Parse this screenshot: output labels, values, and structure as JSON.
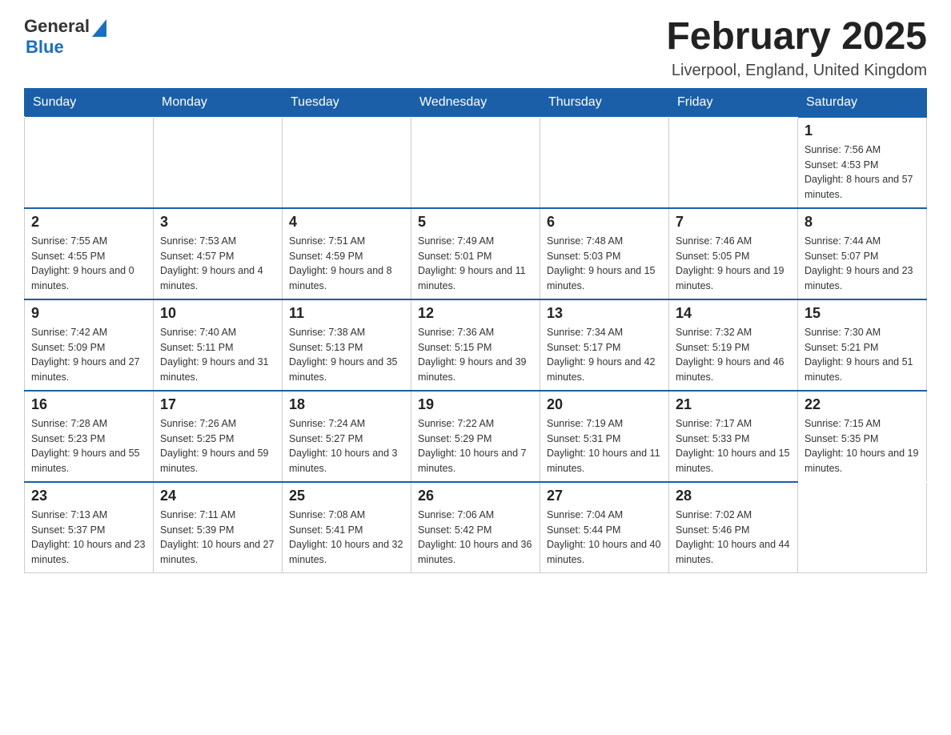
{
  "header": {
    "title": "February 2025",
    "location": "Liverpool, England, United Kingdom",
    "logo_general": "General",
    "logo_blue": "Blue"
  },
  "days_of_week": [
    "Sunday",
    "Monday",
    "Tuesday",
    "Wednesday",
    "Thursday",
    "Friday",
    "Saturday"
  ],
  "weeks": [
    {
      "days": [
        {
          "date": "",
          "info": ""
        },
        {
          "date": "",
          "info": ""
        },
        {
          "date": "",
          "info": ""
        },
        {
          "date": "",
          "info": ""
        },
        {
          "date": "",
          "info": ""
        },
        {
          "date": "",
          "info": ""
        },
        {
          "date": "1",
          "sunrise": "7:56 AM",
          "sunset": "4:53 PM",
          "daylight": "8 hours and 57 minutes."
        }
      ]
    },
    {
      "days": [
        {
          "date": "2",
          "sunrise": "7:55 AM",
          "sunset": "4:55 PM",
          "daylight": "9 hours and 0 minutes."
        },
        {
          "date": "3",
          "sunrise": "7:53 AM",
          "sunset": "4:57 PM",
          "daylight": "9 hours and 4 minutes."
        },
        {
          "date": "4",
          "sunrise": "7:51 AM",
          "sunset": "4:59 PM",
          "daylight": "9 hours and 8 minutes."
        },
        {
          "date": "5",
          "sunrise": "7:49 AM",
          "sunset": "5:01 PM",
          "daylight": "9 hours and 11 minutes."
        },
        {
          "date": "6",
          "sunrise": "7:48 AM",
          "sunset": "5:03 PM",
          "daylight": "9 hours and 15 minutes."
        },
        {
          "date": "7",
          "sunrise": "7:46 AM",
          "sunset": "5:05 PM",
          "daylight": "9 hours and 19 minutes."
        },
        {
          "date": "8",
          "sunrise": "7:44 AM",
          "sunset": "5:07 PM",
          "daylight": "9 hours and 23 minutes."
        }
      ]
    },
    {
      "days": [
        {
          "date": "9",
          "sunrise": "7:42 AM",
          "sunset": "5:09 PM",
          "daylight": "9 hours and 27 minutes."
        },
        {
          "date": "10",
          "sunrise": "7:40 AM",
          "sunset": "5:11 PM",
          "daylight": "9 hours and 31 minutes."
        },
        {
          "date": "11",
          "sunrise": "7:38 AM",
          "sunset": "5:13 PM",
          "daylight": "9 hours and 35 minutes."
        },
        {
          "date": "12",
          "sunrise": "7:36 AM",
          "sunset": "5:15 PM",
          "daylight": "9 hours and 39 minutes."
        },
        {
          "date": "13",
          "sunrise": "7:34 AM",
          "sunset": "5:17 PM",
          "daylight": "9 hours and 42 minutes."
        },
        {
          "date": "14",
          "sunrise": "7:32 AM",
          "sunset": "5:19 PM",
          "daylight": "9 hours and 46 minutes."
        },
        {
          "date": "15",
          "sunrise": "7:30 AM",
          "sunset": "5:21 PM",
          "daylight": "9 hours and 51 minutes."
        }
      ]
    },
    {
      "days": [
        {
          "date": "16",
          "sunrise": "7:28 AM",
          "sunset": "5:23 PM",
          "daylight": "9 hours and 55 minutes."
        },
        {
          "date": "17",
          "sunrise": "7:26 AM",
          "sunset": "5:25 PM",
          "daylight": "9 hours and 59 minutes."
        },
        {
          "date": "18",
          "sunrise": "7:24 AM",
          "sunset": "5:27 PM",
          "daylight": "10 hours and 3 minutes."
        },
        {
          "date": "19",
          "sunrise": "7:22 AM",
          "sunset": "5:29 PM",
          "daylight": "10 hours and 7 minutes."
        },
        {
          "date": "20",
          "sunrise": "7:19 AM",
          "sunset": "5:31 PM",
          "daylight": "10 hours and 11 minutes."
        },
        {
          "date": "21",
          "sunrise": "7:17 AM",
          "sunset": "5:33 PM",
          "daylight": "10 hours and 15 minutes."
        },
        {
          "date": "22",
          "sunrise": "7:15 AM",
          "sunset": "5:35 PM",
          "daylight": "10 hours and 19 minutes."
        }
      ]
    },
    {
      "days": [
        {
          "date": "23",
          "sunrise": "7:13 AM",
          "sunset": "5:37 PM",
          "daylight": "10 hours and 23 minutes."
        },
        {
          "date": "24",
          "sunrise": "7:11 AM",
          "sunset": "5:39 PM",
          "daylight": "10 hours and 27 minutes."
        },
        {
          "date": "25",
          "sunrise": "7:08 AM",
          "sunset": "5:41 PM",
          "daylight": "10 hours and 32 minutes."
        },
        {
          "date": "26",
          "sunrise": "7:06 AM",
          "sunset": "5:42 PM",
          "daylight": "10 hours and 36 minutes."
        },
        {
          "date": "27",
          "sunrise": "7:04 AM",
          "sunset": "5:44 PM",
          "daylight": "10 hours and 40 minutes."
        },
        {
          "date": "28",
          "sunrise": "7:02 AM",
          "sunset": "5:46 PM",
          "daylight": "10 hours and 44 minutes."
        },
        {
          "date": "",
          "info": ""
        }
      ]
    }
  ]
}
